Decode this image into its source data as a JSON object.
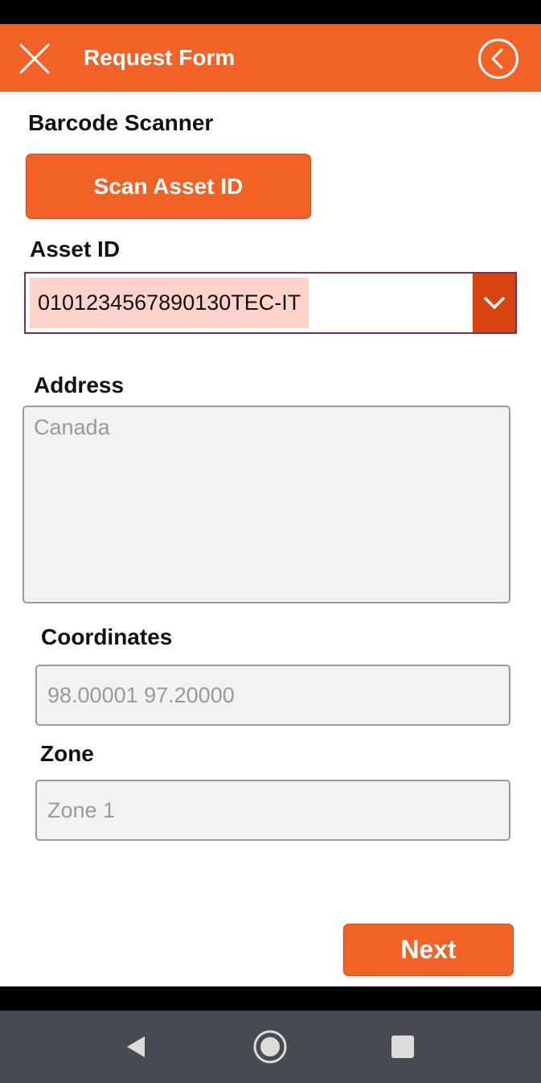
{
  "header": {
    "title": "Request Form",
    "close_icon": "close-icon",
    "back_icon": "circle-chevron-left-icon",
    "color": "#F26226"
  },
  "barcode": {
    "label": "Barcode Scanner",
    "scan_button": "Scan Asset ID"
  },
  "asset": {
    "label": "Asset ID",
    "value": "0101234567890130TEC-IT",
    "dropdown_icon": "chevron-down-icon"
  },
  "address": {
    "label": "Address",
    "value": "Canada"
  },
  "coordinates": {
    "label": "Coordinates",
    "value": "98.00001 97.20000"
  },
  "zone": {
    "label": "Zone",
    "value": "Zone 1"
  },
  "actions": {
    "next_label": "Next"
  },
  "system_nav": {
    "back_icon": "triangle-back-icon",
    "home_icon": "circle-home-icon",
    "recents_icon": "square-recents-icon"
  },
  "colors": {
    "accent": "#F26226",
    "dropdown": "#D9430F",
    "selection_highlight": "#FFD2CC",
    "select_border": "#7b2a5a"
  }
}
